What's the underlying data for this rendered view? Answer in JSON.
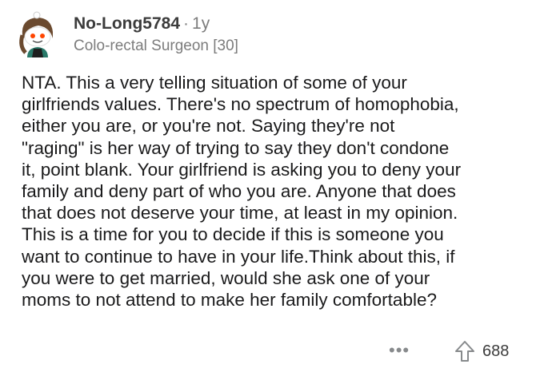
{
  "comment": {
    "author": "No-Long5784",
    "separator": "·",
    "age": "1y",
    "flair": "Colo-rectal Surgeon [30]",
    "avatar_icon": "snoo-avatar-icon",
    "body_lines": [
      "NTA. This a very telling situation of some of your",
      "girlfriends values. There's no spectrum of homophobia,",
      "either you are, or you're not. Saying they're not",
      "\"raging\" is her way of trying to say they don't condone",
      "it, point blank. Your girlfriend is asking you to deny your",
      "family and deny part of who you are. Anyone that does",
      "that does not deserve your time, at least in my opinion.",
      "This is a time for you to decide if this is someone you",
      "want to continue to have in your life.Think about this, if",
      "you were to get married, would she ask one of your",
      "moms to not attend to make her family comfortable?"
    ],
    "more_label": "•••",
    "upvote_icon": "upvote-arrow-icon",
    "score": "688"
  },
  "colors": {
    "text": "#1a1a1b",
    "meta": "#7c7c7c",
    "icon": "#878a8c"
  }
}
